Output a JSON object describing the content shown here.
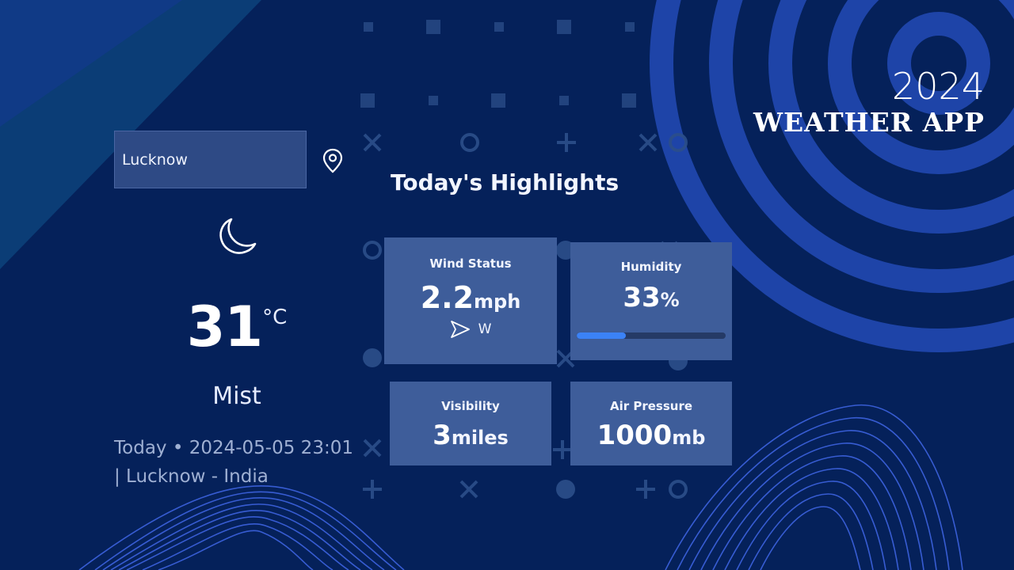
{
  "search": {
    "value": "Lucknow"
  },
  "current": {
    "icon": "moon-icon",
    "temperature": "31",
    "unit": "°C",
    "condition": "Mist",
    "date_line": "Today • 2024-05-05 23:01 | Lucknow - India"
  },
  "highlights": {
    "title": "Today's Highlights",
    "wind": {
      "label": "Wind Status",
      "value": "2.2",
      "unit": "mph",
      "direction_icon": "navigation-arrow-icon",
      "direction": "W"
    },
    "humidity": {
      "label": "Humidity",
      "value": "33",
      "unit": "%",
      "percent": 33
    },
    "visibility": {
      "label": "Visibility",
      "value": "3",
      "unit": "miles"
    },
    "pressure": {
      "label": "Air Pressure",
      "value": "1000",
      "unit": "mb"
    }
  },
  "brand": {
    "year": "2024",
    "name": "WEATHER APP"
  },
  "colors": {
    "background": "#05215a",
    "card": "#3e5d9a",
    "accent": "#3b82f6"
  }
}
